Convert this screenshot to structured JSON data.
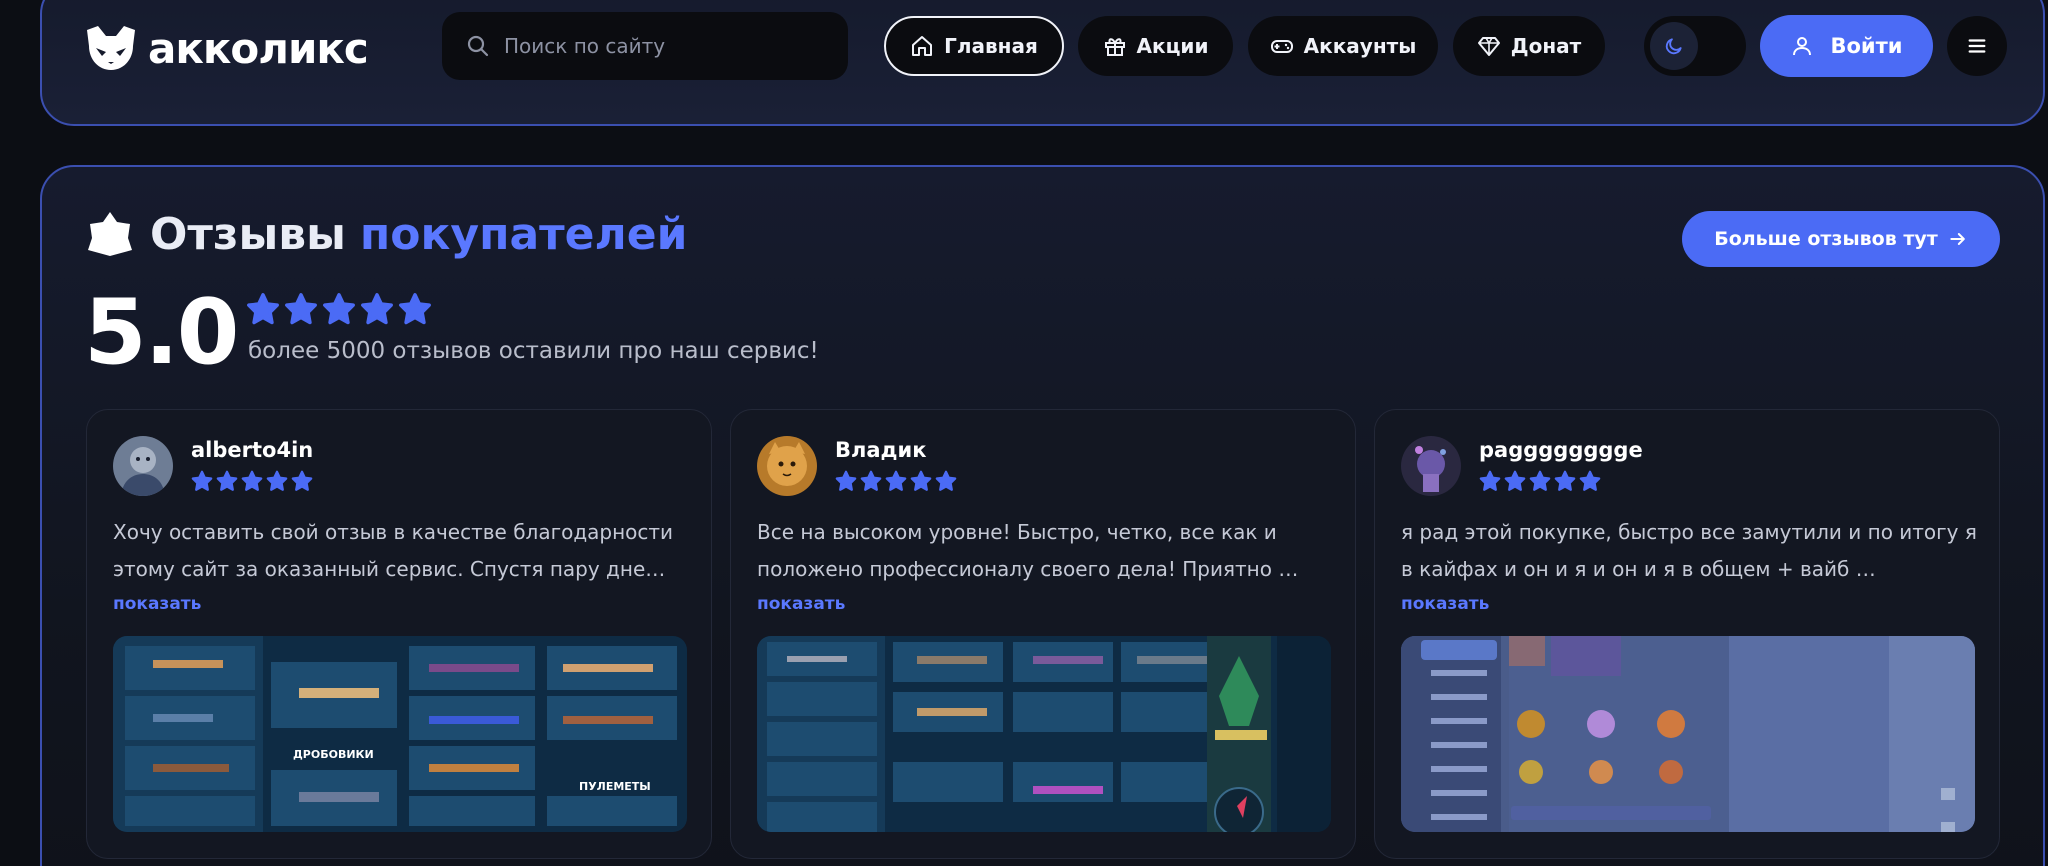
{
  "header": {
    "logo_text": "акколикс",
    "logo_icon": "fox-logo-icon",
    "search_placeholder": "Поиск по сайту",
    "nav": [
      {
        "label": "Главная",
        "icon": "home-icon",
        "active": true
      },
      {
        "label": "Акции",
        "icon": "gift-icon",
        "active": false
      },
      {
        "label": "Аккаунты",
        "icon": "gamepad-icon",
        "active": false
      },
      {
        "label": "Донат",
        "icon": "diamond-icon",
        "active": false
      }
    ],
    "theme_icon": "moon-icon",
    "login_label": "Войти",
    "login_icon": "user-icon",
    "menu_icon": "hamburger-icon"
  },
  "reviews": {
    "title_main": "Отзывы",
    "title_accent": "покупателей",
    "more_label": "Больше отзывов тут",
    "score": "5.0",
    "score_stars": 5,
    "subtitle": "более 5000 отзывов оставили про наш сервис!",
    "show_label": "показать",
    "cards": [
      {
        "name": "alberto4in",
        "rating": 5,
        "text": "Хочу оставить свой отзыв в качестве благодарности этому сайт за оказанный сервис. Спустя пару дне…",
        "image_labels": [
          "ДРОБОВИКИ",
          "ПУЛЕМЕТЫ"
        ]
      },
      {
        "name": "Владик",
        "rating": 5,
        "text": "Все на высоком уровне! Быстро, четко, все как и положено профессионалу своего дела! Приятно …",
        "image_labels": []
      },
      {
        "name": "pagggggggge",
        "rating": 5,
        "text": "я рад этой покупке, быстро все замутили и по итогу я в кайфах и он и я и он и я в общем + вайб …",
        "image_labels": []
      }
    ]
  },
  "colors": {
    "accent": "#4b6bf5",
    "accent_text": "#5a78ff",
    "border": "#3b4fb0",
    "background": "#0c0e14"
  }
}
